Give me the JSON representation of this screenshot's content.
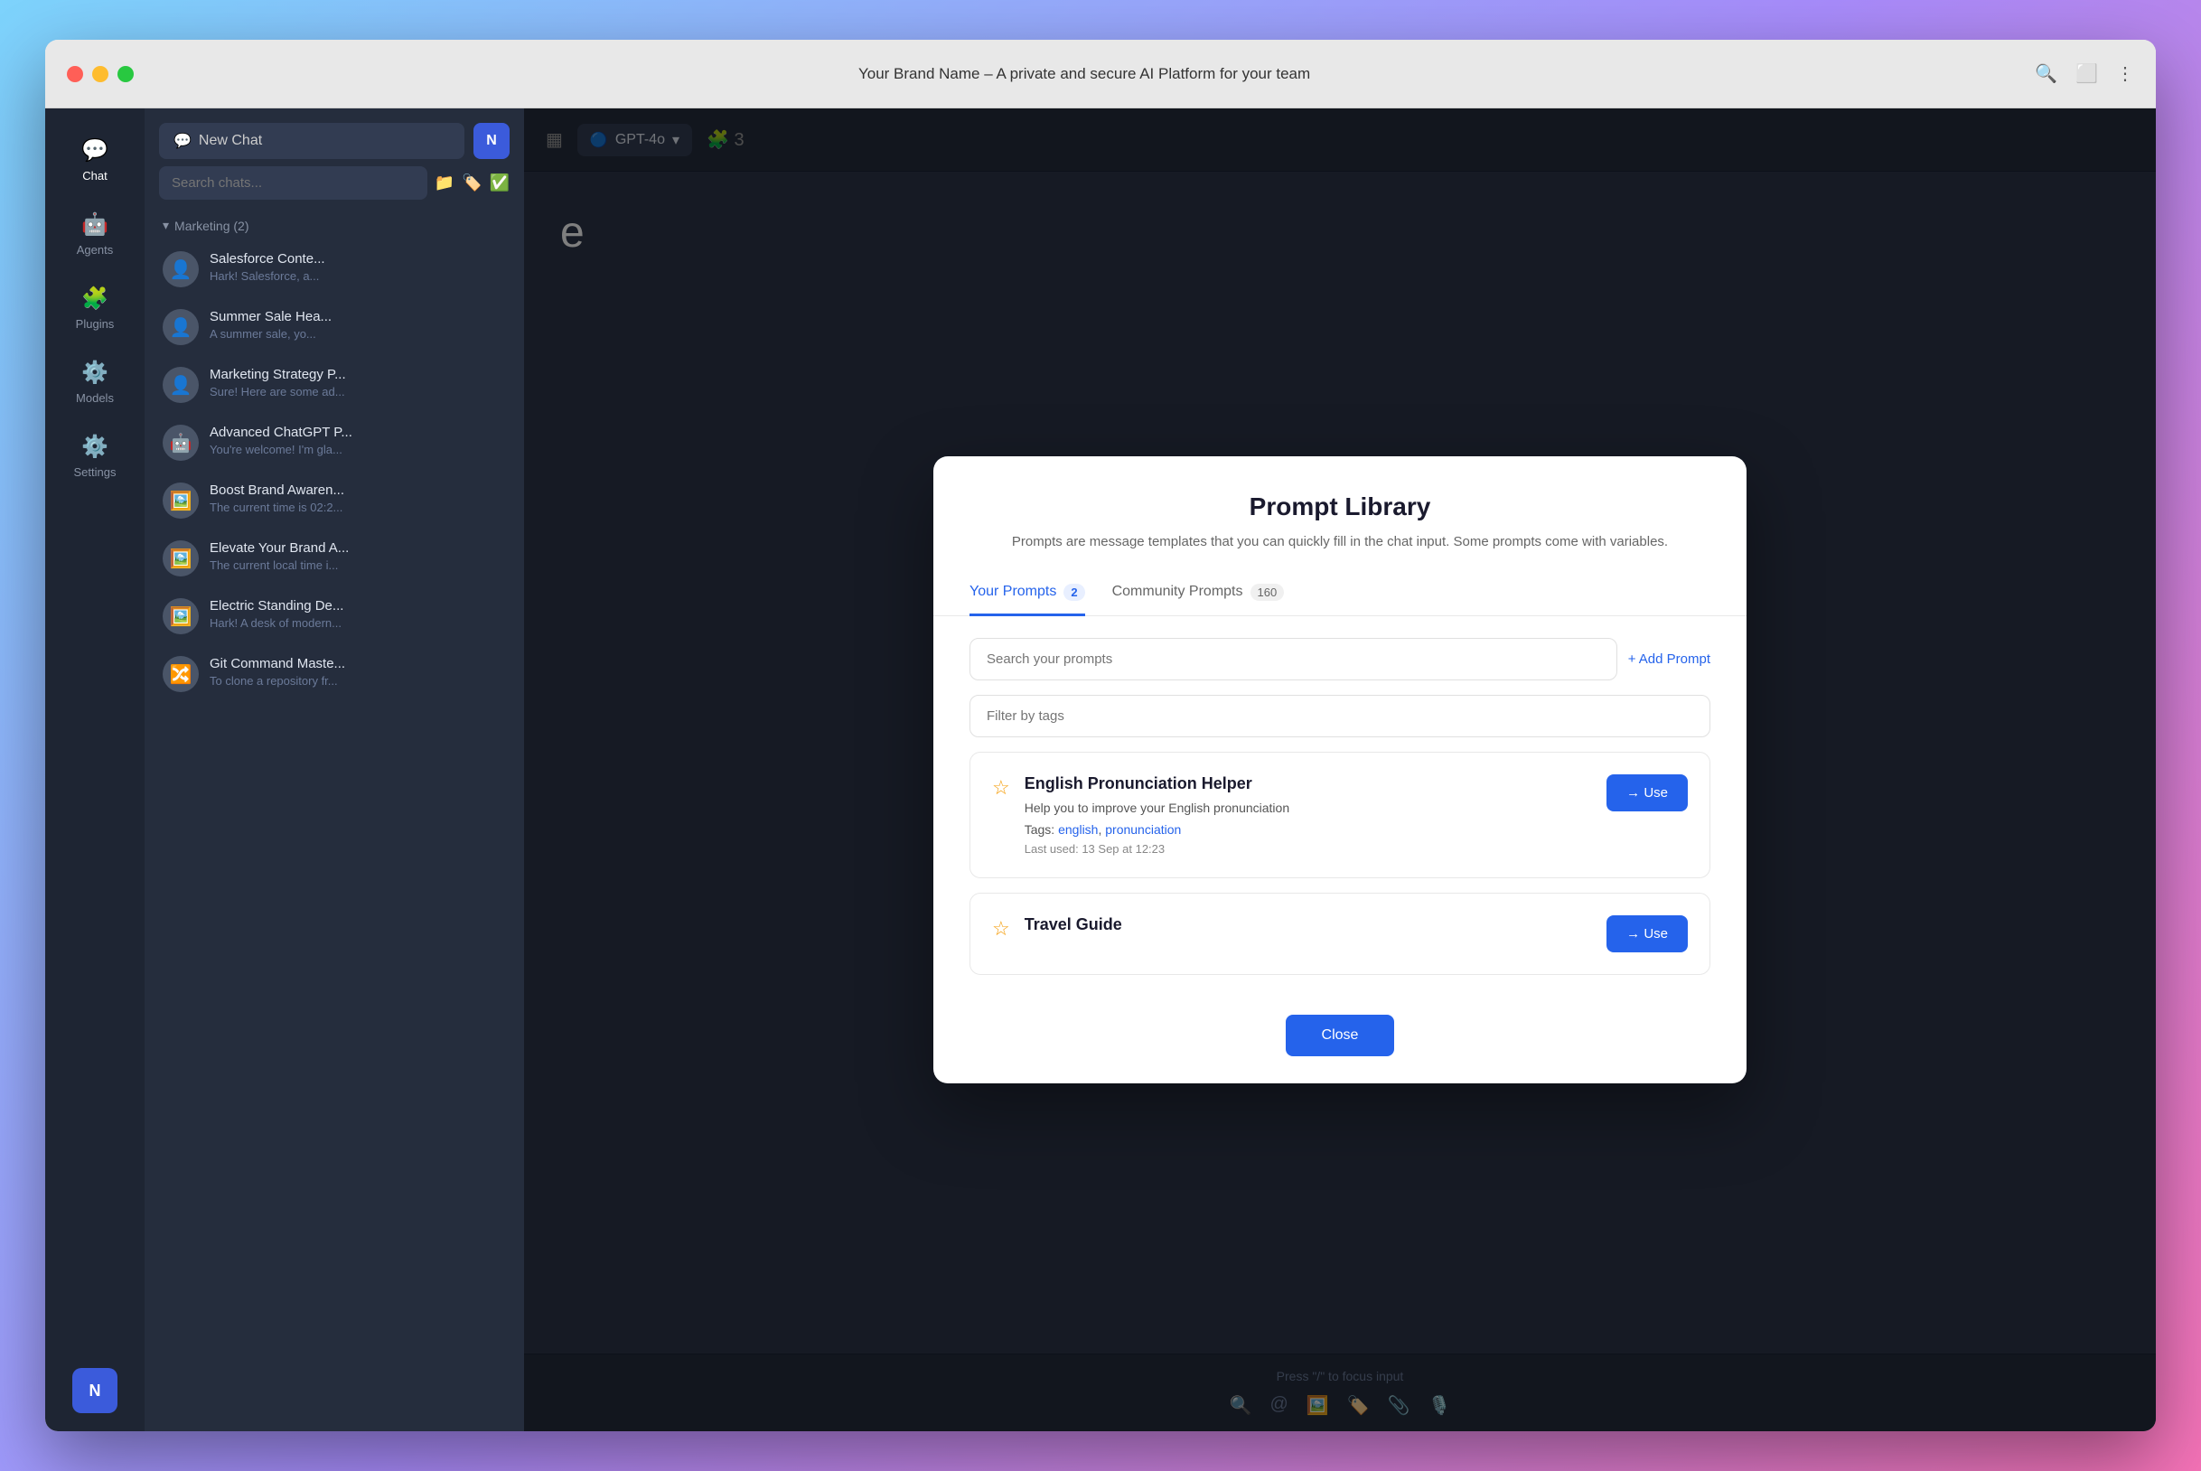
{
  "browser": {
    "title": "Your Brand Name – A private and secure AI Platform for your team"
  },
  "sidebar": {
    "items": [
      {
        "label": "Chat",
        "icon": "💬",
        "active": true
      },
      {
        "label": "Agents",
        "icon": "🤖",
        "active": false
      },
      {
        "label": "Plugins",
        "icon": "🧩",
        "active": false
      },
      {
        "label": "Models",
        "icon": "⚙️",
        "active": false
      },
      {
        "label": "Settings",
        "icon": "⚙️",
        "active": false
      }
    ],
    "user_initial": "N"
  },
  "chat_sidebar": {
    "new_chat_label": "New Chat",
    "search_placeholder": "Search chats...",
    "group_label": "Marketing (2)",
    "chats": [
      {
        "title": "Salesforce Conte...",
        "preview": "Hark! Salesforce, a...",
        "avatar": "👤"
      },
      {
        "title": "Summer Sale Hea...",
        "preview": "A summer sale, yo...",
        "avatar": "👤"
      },
      {
        "title": "Marketing Strategy P...",
        "preview": "Sure! Here are some ad...",
        "avatar": "👤"
      },
      {
        "title": "Advanced ChatGPT P...",
        "preview": "You're welcome! I'm gla...",
        "avatar": "🤖"
      },
      {
        "title": "Boost Brand Awaren...",
        "preview": "The current time is 02:2...",
        "avatar": "🖼️"
      },
      {
        "title": "Elevate Your Brand A...",
        "preview": "The current local time i...",
        "avatar": "🖼️"
      },
      {
        "title": "Electric Standing De...",
        "preview": "Hark! A desk of modern...",
        "avatar": "🖼️"
      },
      {
        "title": "Git Command Maste...",
        "preview": "To clone a repository fr...",
        "avatar": "🔀"
      }
    ]
  },
  "main_header": {
    "model_label": "GPT-4o"
  },
  "footer": {
    "hint": "Press \"/\" to focus input"
  },
  "modal": {
    "title": "Prompt Library",
    "subtitle": "Prompts are message templates that you can quickly fill in the chat input. Some prompts come with variables.",
    "tabs": [
      {
        "label": "Your Prompts",
        "badge": "2",
        "active": true
      },
      {
        "label": "Community Prompts",
        "badge": "160",
        "active": false
      }
    ],
    "search_placeholder": "Search your prompts",
    "add_prompt_label": "+ Add Prompt",
    "filter_placeholder": "Filter by tags",
    "prompts": [
      {
        "name": "English Pronunciation Helper",
        "description": "Help you to improve your English pronunciation",
        "tags_label": "Tags:",
        "tags": [
          "english",
          "pronunciation"
        ],
        "last_used": "Last used: 13 Sep at 12:23",
        "use_label": "→ Use",
        "starred": true
      },
      {
        "name": "Travel Guide",
        "description": "",
        "tags_label": "",
        "tags": [],
        "last_used": "",
        "use_label": "→ Use",
        "starred": true
      }
    ],
    "close_label": "Close"
  }
}
